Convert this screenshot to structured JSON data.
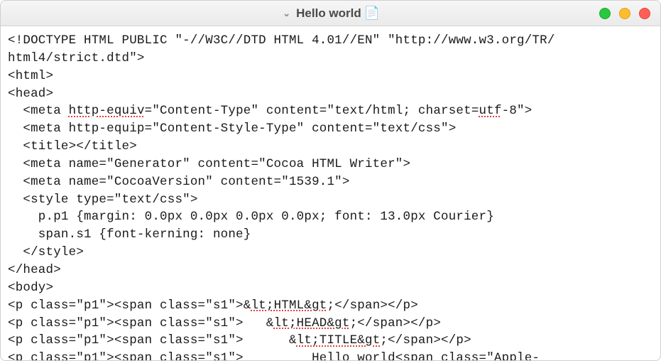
{
  "window": {
    "title": "Hello world"
  },
  "code": {
    "l1": "<!DOCTYPE HTML PUBLIC \"-//W3C//DTD HTML 4.01//EN\" \"http://www.w3.org/TR/",
    "l2": "html4/strict.dtd\">",
    "l3": "<html>",
    "l4": "<head>",
    "l5a": "  <meta ",
    "l5b": "http-equiv",
    "l5c": "=\"Content-Type\" content=\"text/html; charset=",
    "l5d": "utf",
    "l5e": "-8\">",
    "l6": "  <meta http-equip=\"Content-Style-Type\" content=\"text/css\">",
    "l7": "  <title></title>",
    "l8": "  <meta name=\"Generator\" content=\"Cocoa HTML Writer\">",
    "l9": "  <meta name=\"CocoaVersion\" content=\"1539.1\">",
    "l10": "  <style type=\"text/css\">",
    "l11": "    p.p1 {margin: 0.0px 0.0px 0.0px 0.0px; font: 13.0px Courier}",
    "l12": "    span.s1 {font-kerning: none}",
    "l13": "  </style>",
    "l14": "</head>",
    "l15": "<body>",
    "l16a": "<p class=\"p1\"><span class=\"s1\">&",
    "l16b": "lt;HTML&gt",
    "l16c": ";</span></p>",
    "l17a": "<p class=\"p1\"><span class=\"s1\">   &",
    "l17b": "lt;HEAD&gt",
    "l17c": ";</span></p>",
    "l18a": "<p class=\"p1\"><span class=\"s1\">      &",
    "l18b": "lt;TITLE&gt",
    "l18c": ";</span></p>",
    "l19": "<p class=\"p1\"><span class=\"s1\">         Hello world<span class=\"Apple-"
  }
}
